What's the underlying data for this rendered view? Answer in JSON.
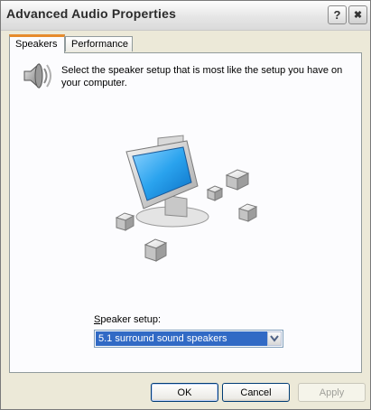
{
  "window": {
    "title": "Advanced Audio Properties",
    "help_glyph": "?",
    "close_glyph": "✖"
  },
  "tabs": [
    {
      "label": "Speakers",
      "selected": true
    },
    {
      "label": "Performance",
      "selected": false
    }
  ],
  "speakers_tab": {
    "icon": "speaker-icon",
    "description": "Select the speaker setup that is most like the setup you have on your computer.",
    "illustration": "monitor-with-surround-speakers",
    "setup_label_underlined": "S",
    "setup_label_rest": "peaker setup:",
    "setup_value": "5.1 surround sound speakers"
  },
  "buttons": {
    "ok": "OK",
    "cancel": "Cancel",
    "apply": "Apply"
  },
  "colors": {
    "selection": "#316ac5",
    "tab_accent": "#e68b2c",
    "button_border": "#003c74"
  }
}
